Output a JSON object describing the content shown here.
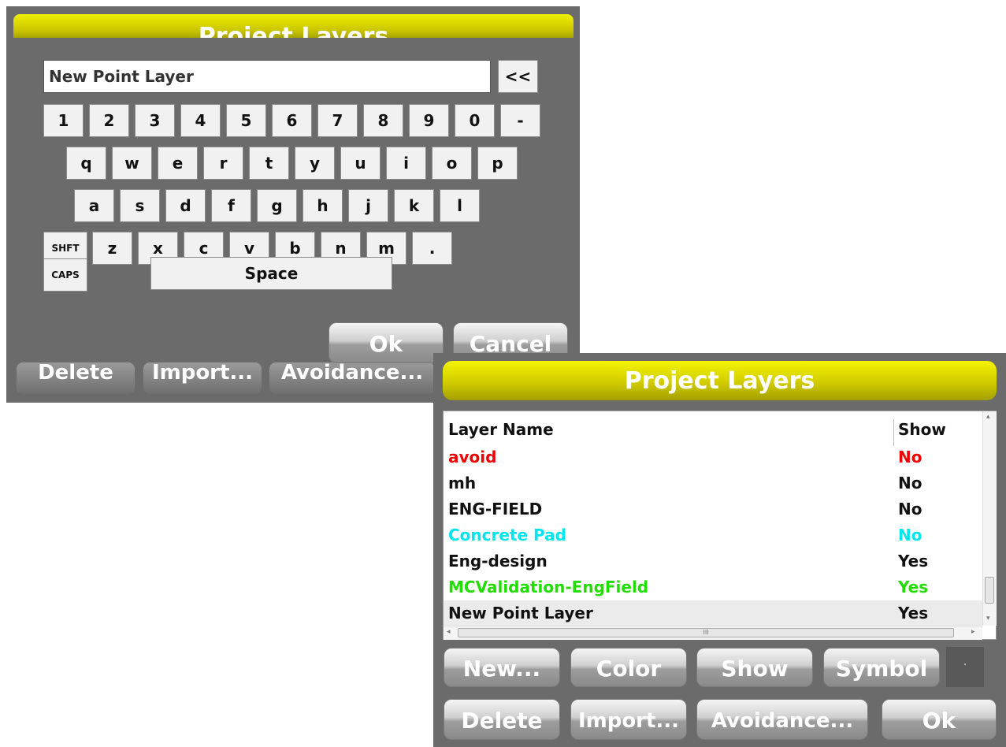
{
  "keyboard_dialog": {
    "title": "Project Layers",
    "text_value": "New Point Layer",
    "backspace_label": "<<",
    "rows": [
      [
        "1",
        "2",
        "3",
        "4",
        "5",
        "6",
        "7",
        "8",
        "9",
        "0",
        "-"
      ],
      [
        "q",
        "w",
        "e",
        "r",
        "t",
        "y",
        "u",
        "i",
        "o",
        "p"
      ],
      [
        "a",
        "s",
        "d",
        "f",
        "g",
        "h",
        "j",
        "k",
        "l"
      ],
      [
        "SHFT",
        "z",
        "x",
        "c",
        "v",
        "b",
        "n",
        "m",
        "."
      ],
      [
        "CAPS",
        "Space"
      ]
    ],
    "ok_label": "Ok",
    "cancel_label": "Cancel",
    "behind_buttons": [
      "Delete",
      "Import...",
      "Avoidance..."
    ]
  },
  "layers_dialog": {
    "title": "Project Layers",
    "columns": [
      "Layer Name",
      "Show"
    ],
    "rows": [
      {
        "name": "avoid",
        "show": "No",
        "color": "#ee0000"
      },
      {
        "name": "mh",
        "show": "No",
        "color": "#111111"
      },
      {
        "name": "ENG-FIELD",
        "show": "No",
        "color": "#111111"
      },
      {
        "name": "Concrete Pad",
        "show": "No",
        "color": "#00e5ee"
      },
      {
        "name": "Eng-design",
        "show": "Yes",
        "color": "#111111"
      },
      {
        "name": "MCValidation-EngField",
        "show": "Yes",
        "color": "#22dd00"
      },
      {
        "name": "New Point Layer",
        "show": "Yes",
        "color": "#111111",
        "selected": true
      }
    ],
    "buttons_row1": [
      "New...",
      "Color",
      "Show",
      "Symbol"
    ],
    "symbol_preview": "·",
    "buttons_row2": [
      "Delete",
      "Import...",
      "Avoidance...",
      "Ok"
    ],
    "hscroll_grip": "III"
  }
}
